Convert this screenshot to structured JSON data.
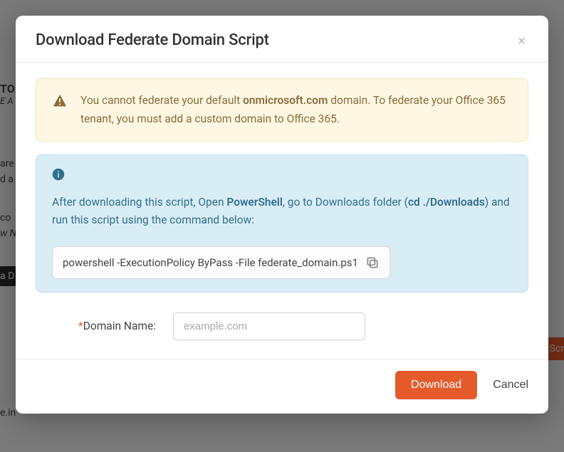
{
  "modal": {
    "title": "Download Federate Domain Script",
    "close_label": "×"
  },
  "warning": {
    "text_before": "You cannot federate your default ",
    "domain_bold": "onmicrosoft.com",
    "text_after": " domain. To federate your Office 365 tenant, you must add a custom domain to Office 365."
  },
  "info": {
    "text_before": "After downloading this script, Open ",
    "powershell_bold": "PowerShell",
    "text_mid": ", go to Downloads folder (",
    "cd_bold": "cd ./Downloads",
    "text_after": ") and run this script using the command below:",
    "command": "powershell -ExecutionPolicy ByPass -File federate_domain.ps1"
  },
  "form": {
    "domain_label": "Domain Name:",
    "required_mark": "*",
    "domain_placeholder": "example.com",
    "domain_value": ""
  },
  "actions": {
    "download": "Download",
    "cancel": "Cancel"
  },
  "background": {
    "heading_fragment": "TO",
    "subheading_fragment": "E A",
    "text1": "are",
    "text2": "d a",
    "text3": "co",
    "text4": "w N",
    "badge": "a D",
    "text5": "e.in",
    "btn_fragment": "Scr"
  }
}
